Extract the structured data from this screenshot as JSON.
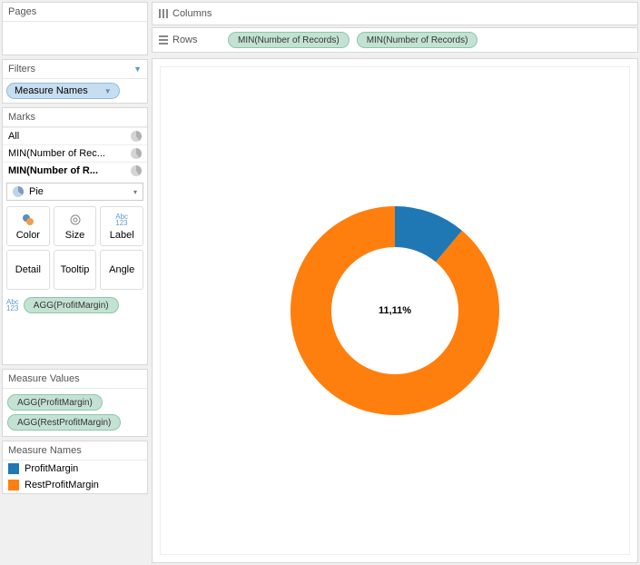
{
  "pages": {
    "title": "Pages"
  },
  "filters": {
    "title": "Filters",
    "item": "Measure Names"
  },
  "marks": {
    "title": "Marks",
    "cards": [
      "All",
      "MIN(Number of Rec...",
      "MIN(Number of R..."
    ],
    "type": "Pie",
    "buttons": {
      "color": "Color",
      "size": "Size",
      "label": "Label",
      "detail": "Detail",
      "tooltip": "Tooltip",
      "angle": "Angle"
    },
    "label_pill": "AGG(ProfitMargin)"
  },
  "measure_values": {
    "title": "Measure Values",
    "items": [
      "AGG(ProfitMargin)",
      "AGG(RestProfitMargin)"
    ]
  },
  "measure_names": {
    "title": "Measure Names",
    "items": [
      {
        "label": "ProfitMargin",
        "color": "#1f77b4"
      },
      {
        "label": "RestProfitMargin",
        "color": "#ff7f0e"
      }
    ]
  },
  "shelves": {
    "columns": "Columns",
    "rows": "Rows",
    "row_pills": [
      "MIN(Number of Records)",
      "MIN(Number of Records)"
    ]
  },
  "chart_data": {
    "type": "pie",
    "title": "",
    "center_label": "11,11%",
    "series": [
      {
        "name": "ProfitMargin",
        "value": 11.11,
        "color": "#1f77b4"
      },
      {
        "name": "RestProfitMargin",
        "value": 88.89,
        "color": "#ff7f0e"
      }
    ]
  }
}
